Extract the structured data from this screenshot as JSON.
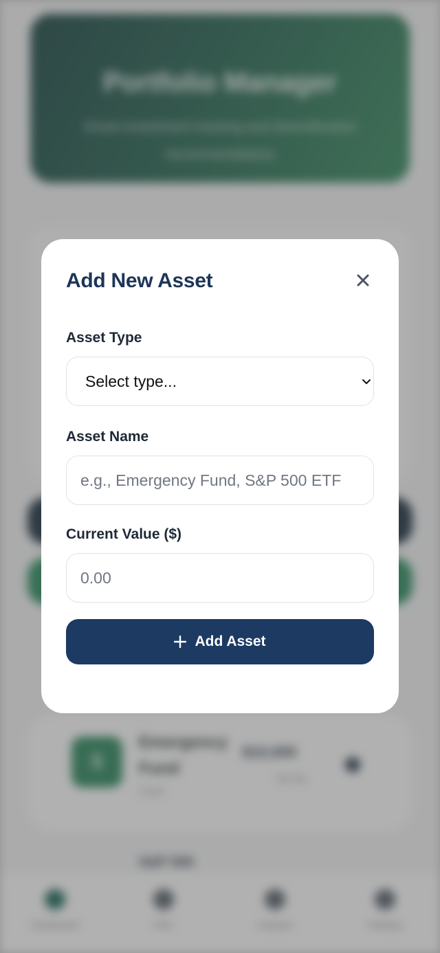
{
  "background": {
    "hero_title": "Portfolio Manager",
    "hero_subtitle": "Smart investment tracking and diversification recommendations",
    "asset_card": {
      "icon": "$",
      "name": "Emergency Fund",
      "type": "Cash",
      "value": "$10,000",
      "percent": "50.0%"
    },
    "next_asset_name": "S&P 500",
    "nav": [
      "Dashboard",
      "Plan",
      "Analysis",
      "Settings"
    ]
  },
  "modal": {
    "title": "Add New Asset",
    "close_icon": "close-icon",
    "asset_type_label": "Asset Type",
    "asset_type_value": "Select type...",
    "asset_name_label": "Asset Name",
    "asset_name_placeholder": "e.g., Emergency Fund, S&P 500 ETF",
    "current_value_label": "Current Value ($)",
    "current_value_placeholder": "0.00",
    "submit_label": "Add Asset",
    "submit_icon": "plus-icon"
  },
  "colors": {
    "accent": "#1d3a63",
    "title": "#1d3557",
    "hero_green": "#2a6a55"
  }
}
